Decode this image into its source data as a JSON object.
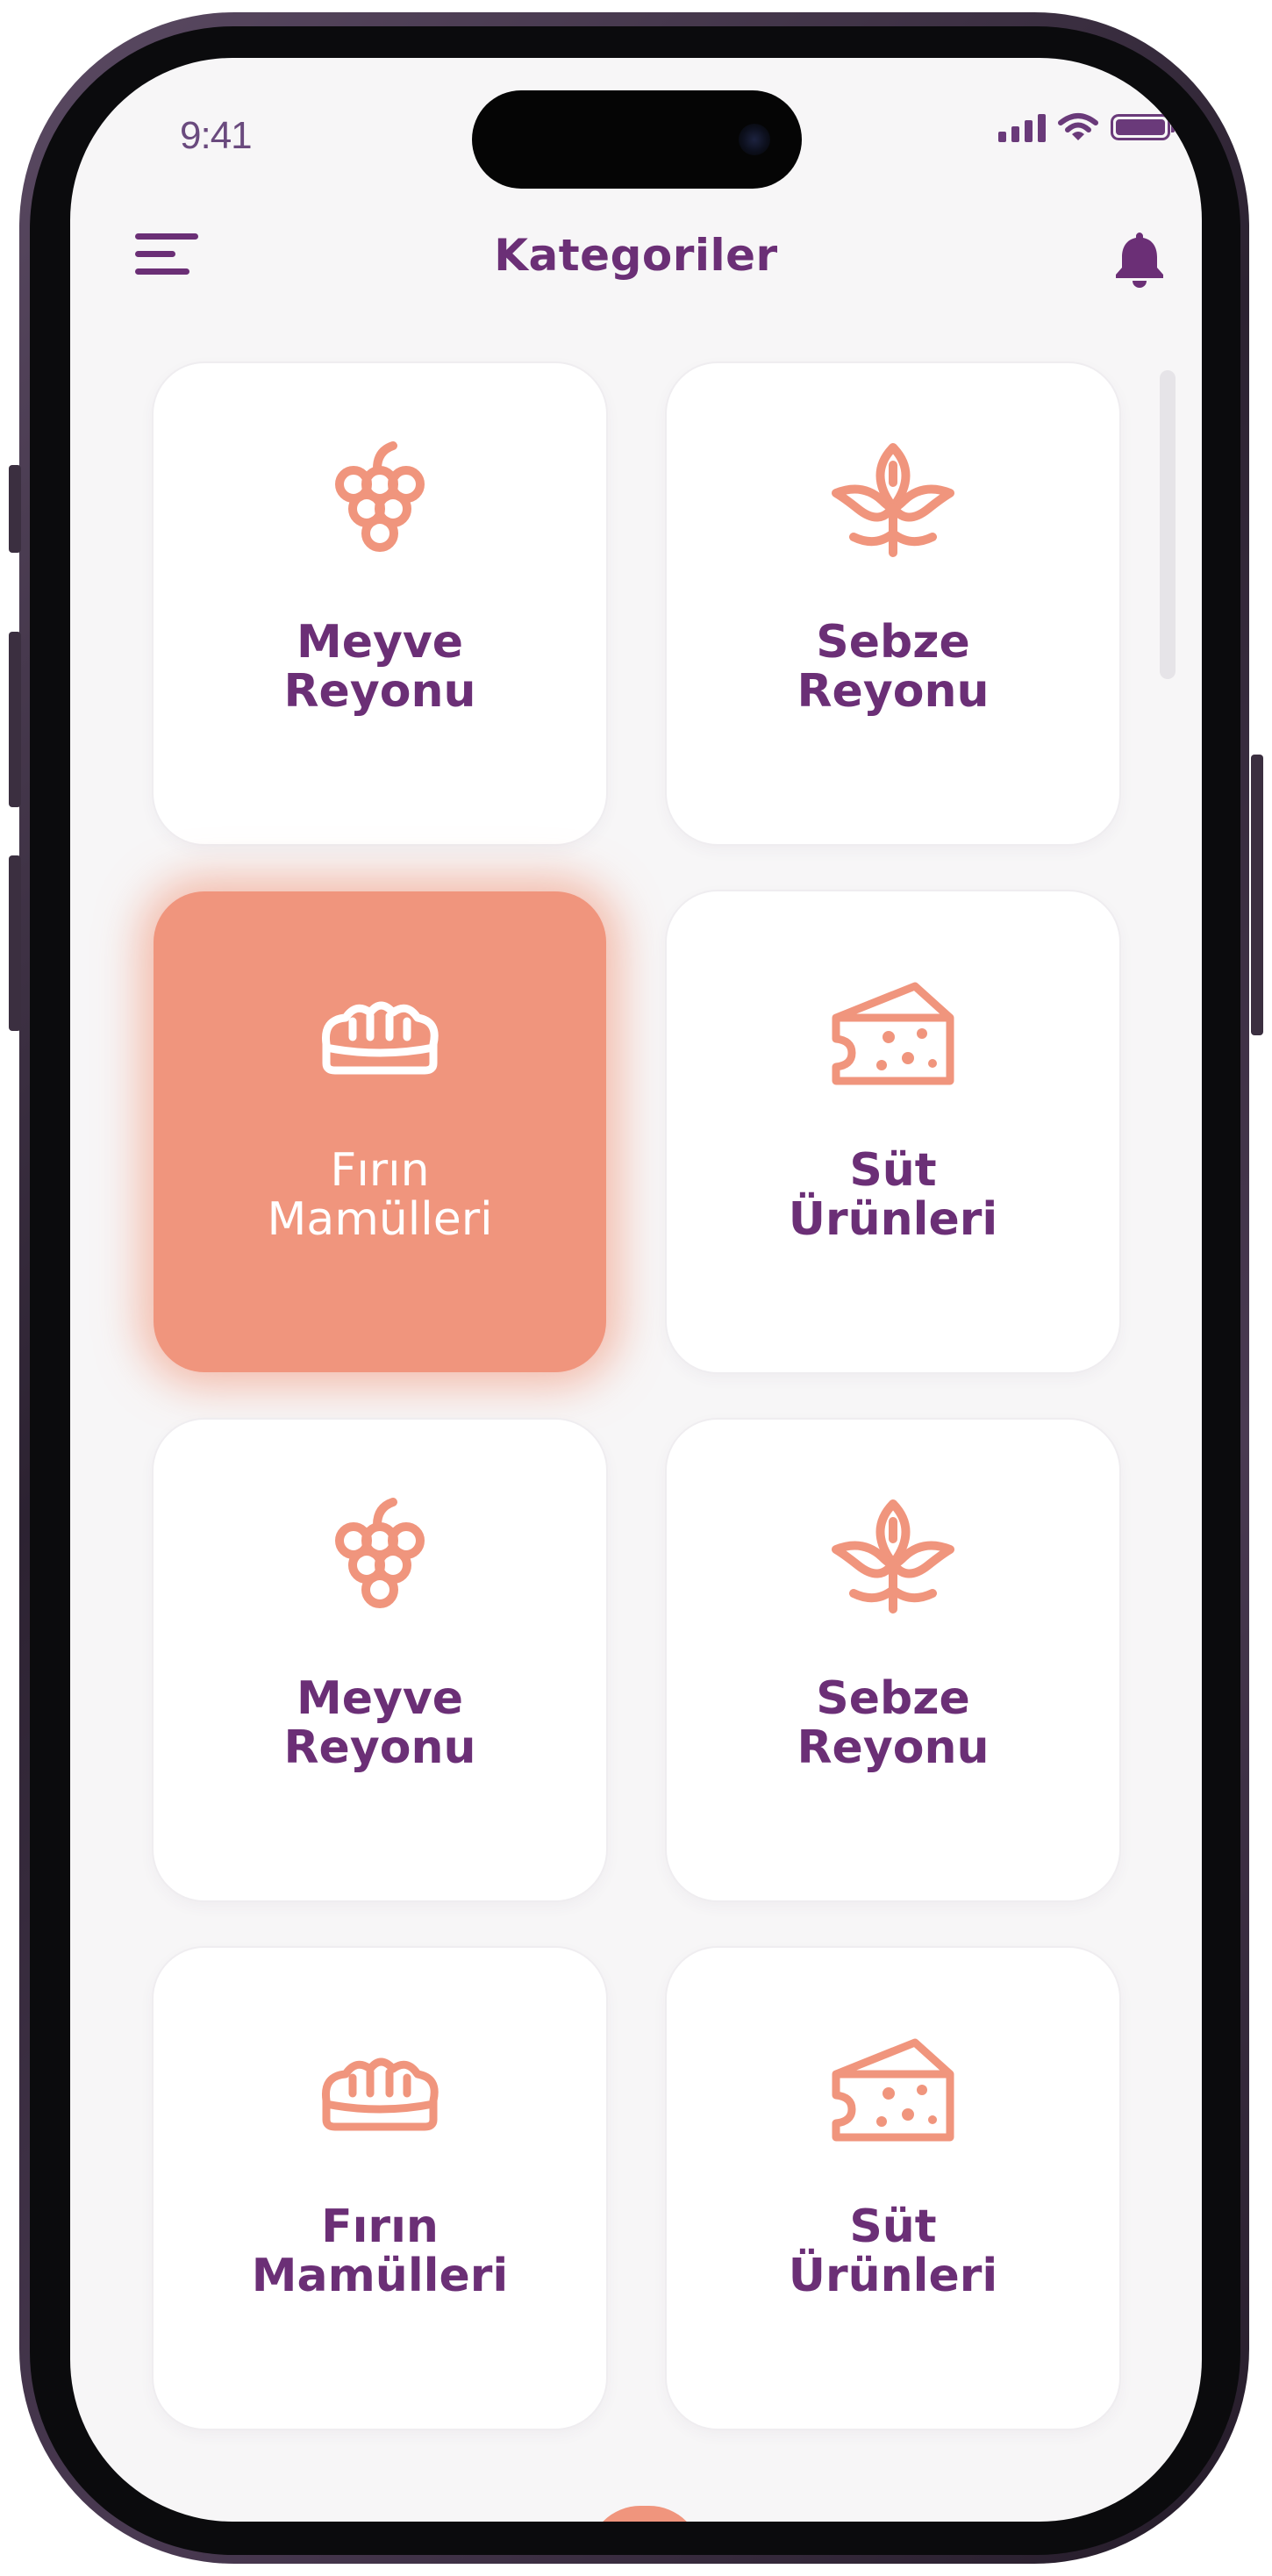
{
  "status_bar": {
    "time": "9:41",
    "icons": [
      "signal-icon",
      "wifi-icon",
      "battery-icon"
    ]
  },
  "header": {
    "title": "Kategoriler",
    "menu_icon": "menu-icon",
    "notification_icon": "bell-icon"
  },
  "colors": {
    "primary": "#6b2f76",
    "accent": "#f0957d",
    "background": "#f7f6f7",
    "card": "#ffffff"
  },
  "categories": [
    {
      "line1": "Meyve",
      "line2": "Reyonu",
      "icon": "grapes-icon",
      "active": false
    },
    {
      "line1": "Sebze",
      "line2": "Reyonu",
      "icon": "sprout-icon",
      "active": false
    },
    {
      "line1": "Fırın",
      "line2": "Mamülleri",
      "icon": "bread-icon",
      "active": true
    },
    {
      "line1": "Süt",
      "line2": "Ürünleri",
      "icon": "cheese-icon",
      "active": false
    },
    {
      "line1": "Meyve",
      "line2": "Reyonu",
      "icon": "grapes-icon",
      "active": false
    },
    {
      "line1": "Sebze",
      "line2": "Reyonu",
      "icon": "sprout-icon",
      "active": false
    },
    {
      "line1": "Fırın",
      "line2": "Mamülleri",
      "icon": "bread-icon",
      "active": false
    },
    {
      "line1": "Süt",
      "line2": "Ürünleri",
      "icon": "cheese-icon",
      "active": false
    }
  ]
}
